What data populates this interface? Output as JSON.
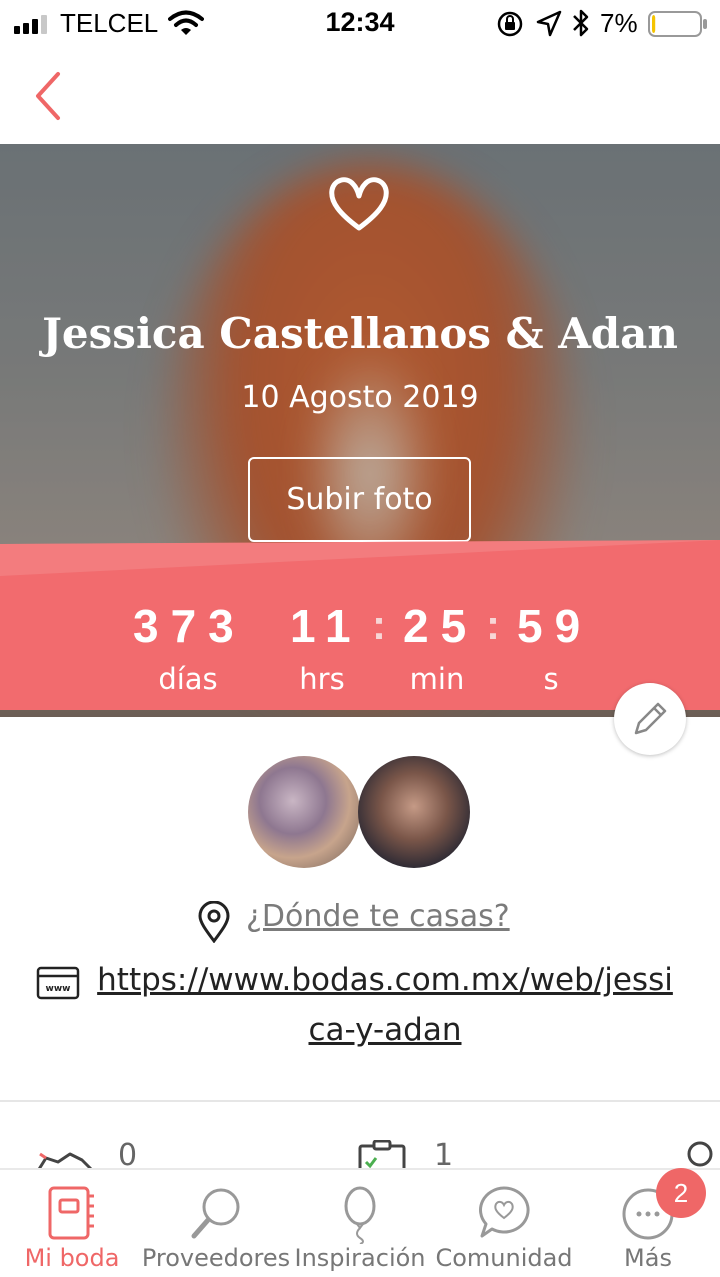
{
  "status_bar": {
    "carrier": "TELCEL",
    "time": "12:34",
    "battery_percent": "7%",
    "battery_level": 0.07,
    "icons": [
      "signal-icon",
      "wifi-icon",
      "orientation-lock-icon",
      "location-icon",
      "bluetooth-icon",
      "battery-icon"
    ]
  },
  "nav": {
    "back_icon": "chevron-left-icon"
  },
  "hero": {
    "icon": "heart-icon",
    "names": "Jessica Castellanos & Adan",
    "date": "10 Agosto 2019",
    "upload_label": "Subir foto"
  },
  "countdown": {
    "days": "373",
    "hours": "11",
    "minutes": "25",
    "seconds": "59",
    "separator": ":",
    "days_label": "días",
    "hours_label": "hrs",
    "minutes_label": "min",
    "seconds_label": "s"
  },
  "profile": {
    "avatars": [
      "partner-1-avatar",
      "partner-2-avatar"
    ]
  },
  "info": {
    "location_prompt": "¿Dónde te casas?",
    "website_url": "https://www.bodas.com.mx/web/jessica-y-adan"
  },
  "stats": [
    {
      "icon": "handshake-icon",
      "value": "0"
    },
    {
      "icon": "checklist-icon",
      "value": "1"
    },
    {
      "icon": "guest-icon",
      "value": ""
    }
  ],
  "tab_bar": {
    "tabs": [
      {
        "label": "Mi boda",
        "icon": "notebook-icon",
        "active": true
      },
      {
        "label": "Proveedores",
        "icon": "magnifier-icon",
        "active": false
      },
      {
        "label": "Inspiración",
        "icon": "balloon-icon",
        "active": false
      },
      {
        "label": "Comunidad",
        "icon": "chat-heart-icon",
        "active": false
      },
      {
        "label": "Más",
        "icon": "more-icon",
        "active": false
      }
    ],
    "more_badge": "2"
  },
  "colors": {
    "accent": "#ef6767",
    "text_dark": "#222222",
    "text_muted": "#7b7b7b"
  }
}
